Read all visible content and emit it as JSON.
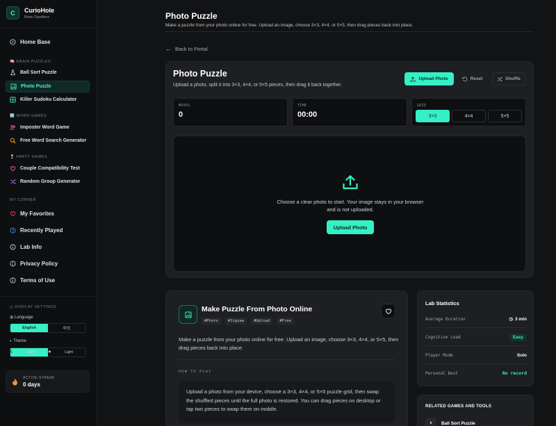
{
  "brand": {
    "logo_letter": "C",
    "name": "CurioHole",
    "subtitle": "Brain Sandbox"
  },
  "sidebar": {
    "home": "Home Base",
    "brain_label": "BRAIN PUZZLES",
    "brain_items": [
      "Ball Sort Puzzle",
      "Photo Puzzle",
      "Killer Sudoku Calculator"
    ],
    "word_label": "WORD GAMES",
    "word_items": [
      "Imposter Word Game",
      "Free Word Search Generator"
    ],
    "party_label": "PARTY GAMES",
    "party_items": [
      "Couple Compatibility Test",
      "Random Group Generator"
    ],
    "corner_label": "MY CORNER",
    "corner_items": [
      "My Favorites",
      "Recently Played",
      "Lab Info",
      "Privacy Policy",
      "Terms of Use"
    ],
    "display_label": "DISPLAY SETTINGS",
    "language_label": "Language",
    "language_options": [
      "English",
      "中文"
    ],
    "theme_label": "Theme",
    "theme_options": [
      "Dark",
      "Light"
    ],
    "streak_label": "ACTIVE STREAK",
    "streak_value": "0 days"
  },
  "header": {
    "title": "Photo Puzzle",
    "description": "Make a puzzle from your photo online for free. Upload an image, choose 3×3, 4×4, or 5×5, then drag pieces back into place.",
    "back": "Back to Portal"
  },
  "game": {
    "title": "Photo Puzzle",
    "description": "Upload a photo, split it into 3×3, 4×4, or 5×5 pieces, then drag it back together.",
    "upload_label": "Upload Photo",
    "reset_label": "Reset",
    "shuffle_label": "Shuffle",
    "moves_label": "MOVES",
    "moves_value": "0",
    "time_label": "TIME",
    "time_value": "00:00",
    "grid_label": "GRID",
    "grid_options": [
      "3×3",
      "4×4",
      "5×5"
    ],
    "drop_line1": "Choose a clear photo to start. Your image stays in your browser",
    "drop_line2": "and is not uploaded.",
    "drop_button": "Upload Photo"
  },
  "info": {
    "title": "Make Puzzle From Photo Online",
    "tags": [
      "#Photo",
      "#Jigsaw",
      "#Upload",
      "#Free"
    ],
    "description": "Make a puzzle from your photo online for free. Upload an image, choose 3×3, 4×4, or 5×5, then drag pieces back into place.",
    "how_to_label": "HOW TO PLAY",
    "how_to_text": "Upload a photo from your device, choose a 3×3, 4×4, or 5×5 puzzle grid, then swap the shuffled pieces until the full photo is restored. You can drag pieces on desktop or tap two pieces to swap them on mobile."
  },
  "lab": {
    "title": "Lab Statistics",
    "rows": [
      {
        "k": "Average Duration",
        "v": "3 min"
      },
      {
        "k": "Cognitive Load",
        "v": "Easy"
      },
      {
        "k": "Player Mode",
        "v": "Solo"
      },
      {
        "k": "Personal Best",
        "v": "No record"
      }
    ]
  },
  "related": {
    "title": "RELATED GAMES AND TOOLS",
    "first_item": "Ball Sort Puzzle"
  },
  "colors": {
    "accent": "#35f0c4",
    "background": "#121315",
    "panel": "#1d1f22",
    "active_nav": "#0f2a27"
  }
}
